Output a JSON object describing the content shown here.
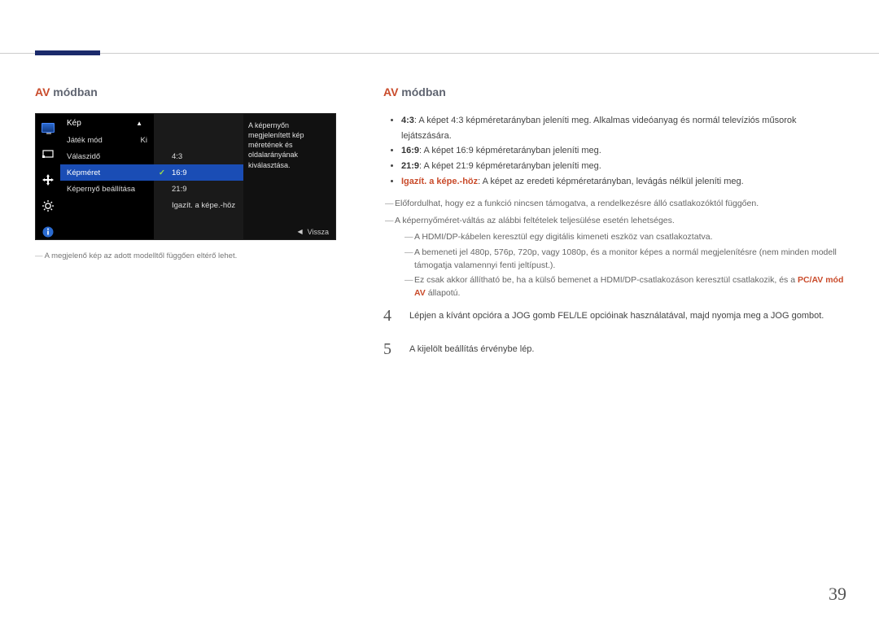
{
  "page_number": "39",
  "left": {
    "title_accent": "AV",
    "title_rest": " módban",
    "caption": "A megjelenő kép az adott modelltől függően eltérő lehet.",
    "osd": {
      "header": "Kép",
      "help_text": "A képernyőn megjelenített kép méretének és oldalarányának kiválasztása.",
      "col1": {
        "row1_label": "Játék mód",
        "row1_value": "Ki",
        "row2_label": "Válaszidő",
        "row3_label": "Képméret",
        "row4_label": "Képernyő beállítása"
      },
      "col2": {
        "opt1": "4:3",
        "opt2": "16:9",
        "opt3": "21:9",
        "opt4": "Igazít. a képe.-höz"
      },
      "footer_back": "Vissza"
    }
  },
  "right": {
    "title_accent": "AV",
    "title_rest": " módban",
    "bullets": [
      {
        "bold": "4:3",
        "text": ": A képet 4:3 képméretarányban jeleníti meg. Alkalmas videóanyag és normál televíziós műsorok lejátszására."
      },
      {
        "bold": "16:9",
        "text": ": A képet 16:9 képméretarányban jeleníti meg."
      },
      {
        "bold": "21:9",
        "text": ": A képet 21:9 képméretarányban jeleníti meg."
      },
      {
        "bold_accent": "Igazít. a képe.-höz",
        "text": ": A képet az eredeti képméretarányban, levágás nélkül jeleníti meg."
      }
    ],
    "note1": "Előfordulhat, hogy ez a funkció nincsen támogatva, a rendelkezésre álló csatlakozóktól függően.",
    "note2": "A képernyőméret-váltás az alábbi feltételek teljesülése esetén lehetséges.",
    "sub1": "A HDMI/DP-kábelen keresztül egy digitális kimeneti eszköz van csatlakoztatva.",
    "sub2": "A bemeneti jel 480p, 576p, 720p, vagy 1080p, és a monitor képes a normál megjelenítésre (nem minden modell támogatja valamennyi fenti jeltípust.).",
    "sub3_pre": "Ez csak akkor állítható be, ha a külső bemenet a HDMI/DP-csatlakozáson keresztül csatlakozik, és a ",
    "sub3_accent": "PC/AV mód AV",
    "sub3_post": " állapotú.",
    "step4": "Lépjen a kívánt opcióra a JOG gomb FEL/LE opcióinak használatával, majd nyomja meg a JOG gombot.",
    "step5": "A kijelölt beállítás érvénybe lép."
  }
}
